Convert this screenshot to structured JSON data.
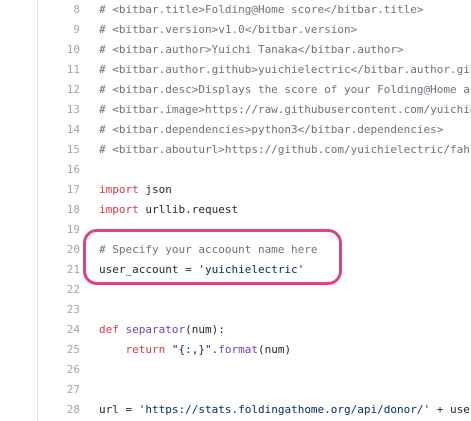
{
  "colors": {
    "comment": "#6a737d",
    "keyword": "#d73a49",
    "string": "#032f62",
    "function": "#6f42c1",
    "text": "#24292e",
    "line_number": "#a6a6a6",
    "highlight_ring": "#e23f85"
  },
  "code": {
    "lines": [
      {
        "n": "8",
        "tokens": [
          {
            "t": "comment",
            "v": "# <bitbar.title>Folding@Home score</bitbar.title>"
          }
        ]
      },
      {
        "n": "9",
        "tokens": [
          {
            "t": "comment",
            "v": "# <bitbar.version>v1.0</bitbar.version>"
          }
        ]
      },
      {
        "n": "10",
        "tokens": [
          {
            "t": "comment",
            "v": "# <bitbar.author>Yuichi Tanaka</bitbar.author>"
          }
        ]
      },
      {
        "n": "11",
        "tokens": [
          {
            "t": "comment",
            "v": "# <bitbar.author.github>yuichielectric</bitbar.author.git"
          }
        ]
      },
      {
        "n": "12",
        "tokens": [
          {
            "t": "comment",
            "v": "# <bitbar.desc>Displays the score of your Folding@Home acc"
          }
        ]
      },
      {
        "n": "13",
        "tokens": [
          {
            "t": "comment",
            "v": "# <bitbar.image>https://raw.githubusercontent.com/yuichie"
          }
        ]
      },
      {
        "n": "14",
        "tokens": [
          {
            "t": "comment",
            "v": "# <bitbar.dependencies>python3</bitbar.dependencies>"
          }
        ]
      },
      {
        "n": "15",
        "tokens": [
          {
            "t": "comment",
            "v": "# <bitbar.abouturl>https://github.com/yuichielectric/fah-"
          }
        ]
      },
      {
        "n": "16",
        "tokens": []
      },
      {
        "n": "17",
        "tokens": [
          {
            "t": "keyword",
            "v": "import"
          },
          {
            "t": "plain",
            "v": " json"
          }
        ]
      },
      {
        "n": "18",
        "tokens": [
          {
            "t": "keyword",
            "v": "import"
          },
          {
            "t": "plain",
            "v": " urllib.request"
          }
        ]
      },
      {
        "n": "19",
        "tokens": []
      },
      {
        "n": "20",
        "tokens": [
          {
            "t": "comment",
            "v": "# Specify your accoount name here"
          }
        ]
      },
      {
        "n": "21",
        "tokens": [
          {
            "t": "plain",
            "v": "user_account = "
          },
          {
            "t": "string",
            "v": "'yuichielectric'"
          }
        ]
      },
      {
        "n": "22",
        "tokens": []
      },
      {
        "n": "23",
        "tokens": []
      },
      {
        "n": "24",
        "tokens": [
          {
            "t": "keyword",
            "v": "def"
          },
          {
            "t": "plain",
            "v": " "
          },
          {
            "t": "func",
            "v": "separator"
          },
          {
            "t": "plain",
            "v": "(num):"
          }
        ]
      },
      {
        "n": "25",
        "tokens": [
          {
            "t": "plain",
            "v": "    "
          },
          {
            "t": "keyword",
            "v": "return"
          },
          {
            "t": "plain",
            "v": " "
          },
          {
            "t": "string",
            "v": "\"{:,}\""
          },
          {
            "t": "plain",
            "v": "."
          },
          {
            "t": "func",
            "v": "format"
          },
          {
            "t": "plain",
            "v": "(num)"
          }
        ]
      },
      {
        "n": "26",
        "tokens": []
      },
      {
        "n": "27",
        "tokens": []
      },
      {
        "n": "28",
        "tokens": [
          {
            "t": "plain",
            "v": "url = "
          },
          {
            "t": "string",
            "v": "'https://stats.foldingathome.org/api/donor/'"
          },
          {
            "t": "plain",
            "v": " + user"
          }
        ]
      }
    ],
    "highlighted_line_numbers": [
      "20",
      "21"
    ]
  }
}
